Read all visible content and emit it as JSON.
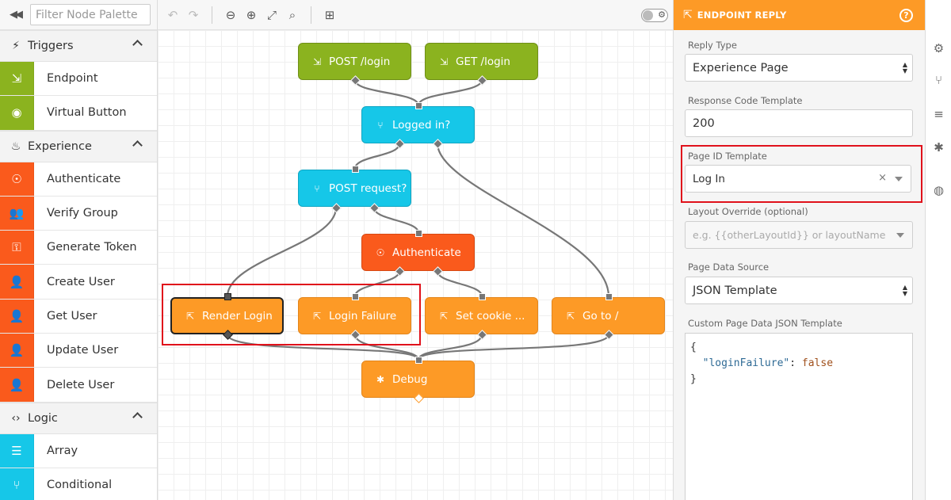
{
  "palette": {
    "search_placeholder": "Filter Node Palette",
    "categories": [
      {
        "label": "Triggers",
        "icon": "bolt-icon",
        "items": [
          {
            "label": "Endpoint",
            "icon": "endpoint-icon",
            "color": "#8bb31f"
          },
          {
            "label": "Virtual Button",
            "icon": "target-icon",
            "color": "#8bb31f"
          }
        ]
      },
      {
        "label": "Experience",
        "icon": "flame-icon",
        "items": [
          {
            "label": "Authenticate",
            "icon": "fingerprint-icon",
            "color": "#fa5a1c"
          },
          {
            "label": "Verify Group",
            "icon": "users-icon",
            "color": "#fa5a1c"
          },
          {
            "label": "Generate Token",
            "icon": "key-icon",
            "color": "#fa5a1c"
          },
          {
            "label": "Create User",
            "icon": "user-plus-icon",
            "color": "#fa5a1c"
          },
          {
            "label": "Get User",
            "icon": "user-search-icon",
            "color": "#fa5a1c"
          },
          {
            "label": "Update User",
            "icon": "user-edit-icon",
            "color": "#fa5a1c"
          },
          {
            "label": "Delete User",
            "icon": "user-delete-icon",
            "color": "#fa5a1c"
          }
        ]
      },
      {
        "label": "Logic",
        "icon": "code-icon",
        "items": [
          {
            "label": "Array",
            "icon": "list-icon",
            "color": "#16c7e8"
          },
          {
            "label": "Conditional",
            "icon": "branch-icon",
            "color": "#16c7e8"
          }
        ]
      }
    ]
  },
  "canvas": {
    "nodes": {
      "post_login": "POST /login",
      "get_login": "GET /login",
      "logged_in": "Logged in?",
      "post_request": "POST request?",
      "authenticate": "Authenticate",
      "render_login": "Render Login",
      "login_failure": "Login Failure",
      "set_cookie": "Set cookie ...",
      "go_to": "Go to /",
      "debug": "Debug"
    },
    "colors": {
      "trigger": "#8bb31f",
      "logic": "#16c7e8",
      "experience": "#fa5a1c",
      "output": "#fd9a26",
      "highlight": "#e0111b"
    }
  },
  "panel": {
    "title": "ENDPOINT REPLY",
    "help": "?",
    "reply_type": {
      "label": "Reply Type",
      "value": "Experience Page"
    },
    "response_code": {
      "label": "Response Code Template",
      "value": "200"
    },
    "page_id": {
      "label": "Page ID Template",
      "value": "Log In",
      "clear": "×"
    },
    "layout_override": {
      "label": "Layout Override (optional)",
      "placeholder": "e.g. {{otherLayoutId}} or layoutName"
    },
    "page_data_source": {
      "label": "Page Data Source",
      "value": "JSON Template"
    },
    "custom_json": {
      "label": "Custom Page Data JSON Template",
      "open": "{",
      "key": "\"loginFailure\"",
      "colon": ": ",
      "value": "false",
      "close": "}"
    }
  }
}
